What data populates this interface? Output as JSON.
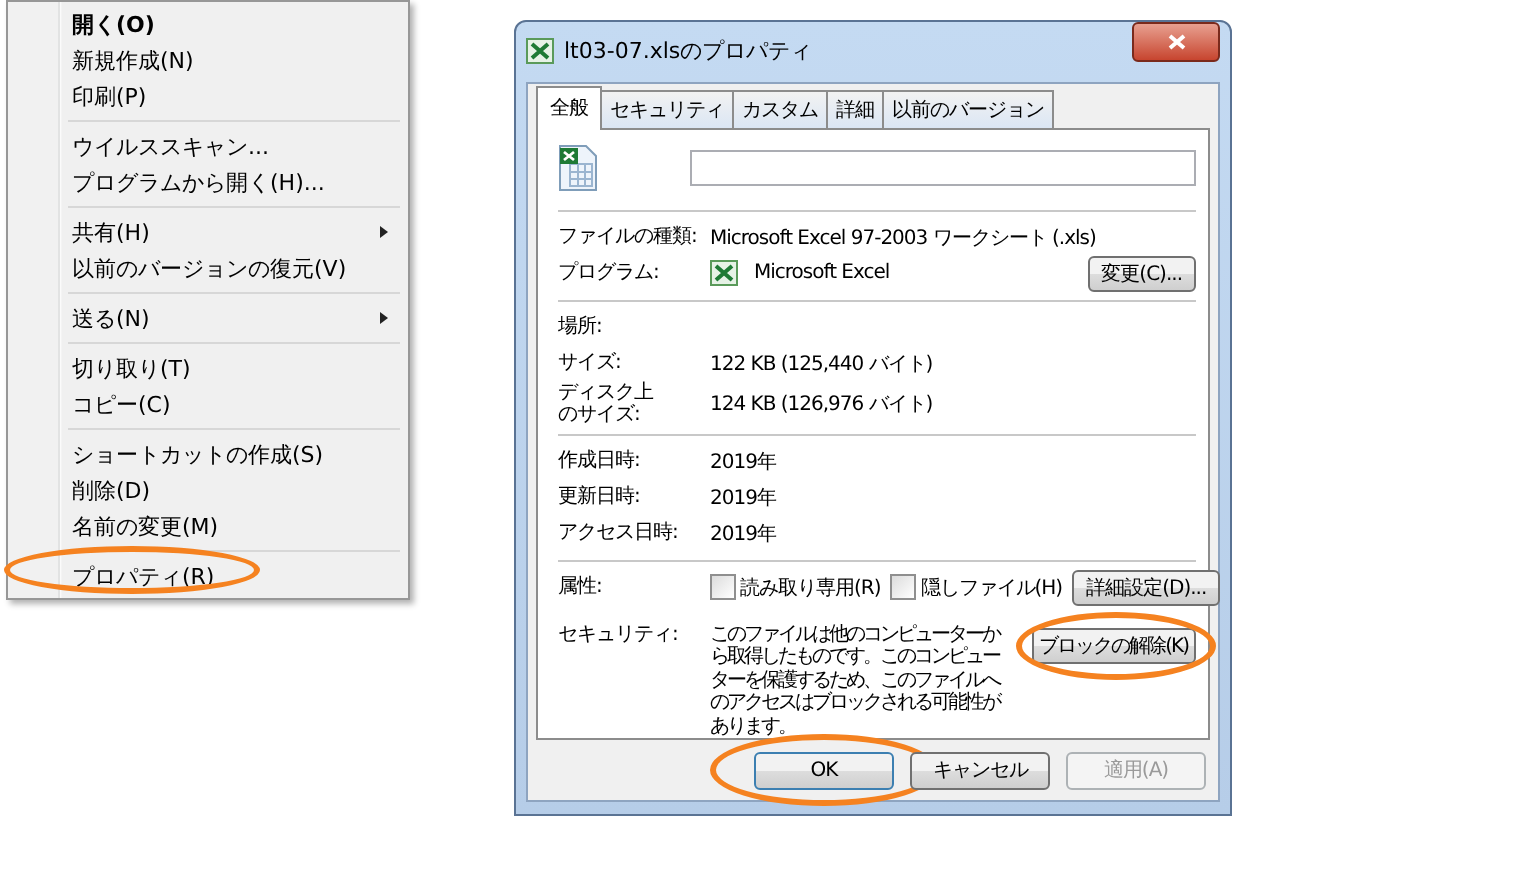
{
  "context_menu": {
    "groups": [
      [
        {
          "label": "開く(O)",
          "default": true,
          "submenu": false,
          "highlighted": false
        },
        {
          "label": "新規作成(N)",
          "default": false,
          "submenu": false,
          "highlighted": false
        },
        {
          "label": "印刷(P)",
          "default": false,
          "submenu": false,
          "highlighted": false
        }
      ],
      [
        {
          "label": "ウイルススキャン...",
          "default": false,
          "submenu": false,
          "highlighted": false
        },
        {
          "label": "プログラムから開く(H)...",
          "default": false,
          "submenu": false,
          "highlighted": false
        }
      ],
      [
        {
          "label": "共有(H)",
          "default": false,
          "submenu": true,
          "highlighted": false
        },
        {
          "label": "以前のバージョンの復元(V)",
          "default": false,
          "submenu": false,
          "highlighted": false
        }
      ],
      [
        {
          "label": "送る(N)",
          "default": false,
          "submenu": true,
          "highlighted": false
        }
      ],
      [
        {
          "label": "切り取り(T)",
          "default": false,
          "submenu": false,
          "highlighted": false
        },
        {
          "label": "コピー(C)",
          "default": false,
          "submenu": false,
          "highlighted": false
        }
      ],
      [
        {
          "label": "ショートカットの作成(S)",
          "default": false,
          "submenu": false,
          "highlighted": false
        },
        {
          "label": "削除(D)",
          "default": false,
          "submenu": false,
          "highlighted": false
        },
        {
          "label": "名前の変更(M)",
          "default": false,
          "submenu": false,
          "highlighted": false
        }
      ],
      [
        {
          "label": "プロパティ(R)",
          "default": false,
          "submenu": false,
          "highlighted": true
        }
      ]
    ]
  },
  "dialog": {
    "title": "lt03-07.xlsのプロパティ",
    "tabs": [
      {
        "label": "全般",
        "selected": true
      },
      {
        "label": "セキュリティ",
        "selected": false
      },
      {
        "label": "カスタム",
        "selected": false
      },
      {
        "label": "詳細",
        "selected": false
      },
      {
        "label": "以前のバージョン",
        "selected": false
      }
    ],
    "file_type": {
      "label": "ファイルの種類:",
      "value": "Microsoft Excel 97-2003 ワークシート (.xls)"
    },
    "program": {
      "label": "プログラム:",
      "value": "Microsoft Excel",
      "button": {
        "label": "変更(C)..."
      }
    },
    "location_group": [
      {
        "label": "場所:"
      },
      {
        "label": "サイズ:",
        "value": "122 KB (125,440 バイト)"
      },
      {
        "label_lines": [
          "ディスク上",
          "のサイズ:"
        ],
        "value": "124 KB (126,976 バイト)"
      }
    ],
    "date_group": [
      {
        "label": "作成日時:",
        "value": "2019年"
      },
      {
        "label": "更新日時:",
        "value": "2019年"
      },
      {
        "label": "アクセス日時:",
        "value": "2019年"
      }
    ],
    "attributes": {
      "label": "属性:",
      "checkboxes": [
        {
          "label": "読み取り専用(R)",
          "checked": false
        },
        {
          "label": "隠しファイル(H)",
          "checked": false
        }
      ],
      "button": {
        "label": "詳細設定(D)..."
      }
    },
    "security": {
      "label": "セキュリティ:",
      "text": "このファイルは他のコンピューターから取得したものです。このコンピューターを保護するため、このファイルへのアクセスはブロックされる可能性があります。",
      "button": {
        "label": "ブロックの解除(K)",
        "highlighted": true
      }
    },
    "buttons": [
      {
        "label": "OK",
        "disabled": false,
        "highlighted": true
      },
      {
        "label": "キャンセル",
        "disabled": false,
        "highlighted": false
      },
      {
        "label": "適用(A)",
        "disabled": true,
        "highlighted": false
      }
    ]
  }
}
